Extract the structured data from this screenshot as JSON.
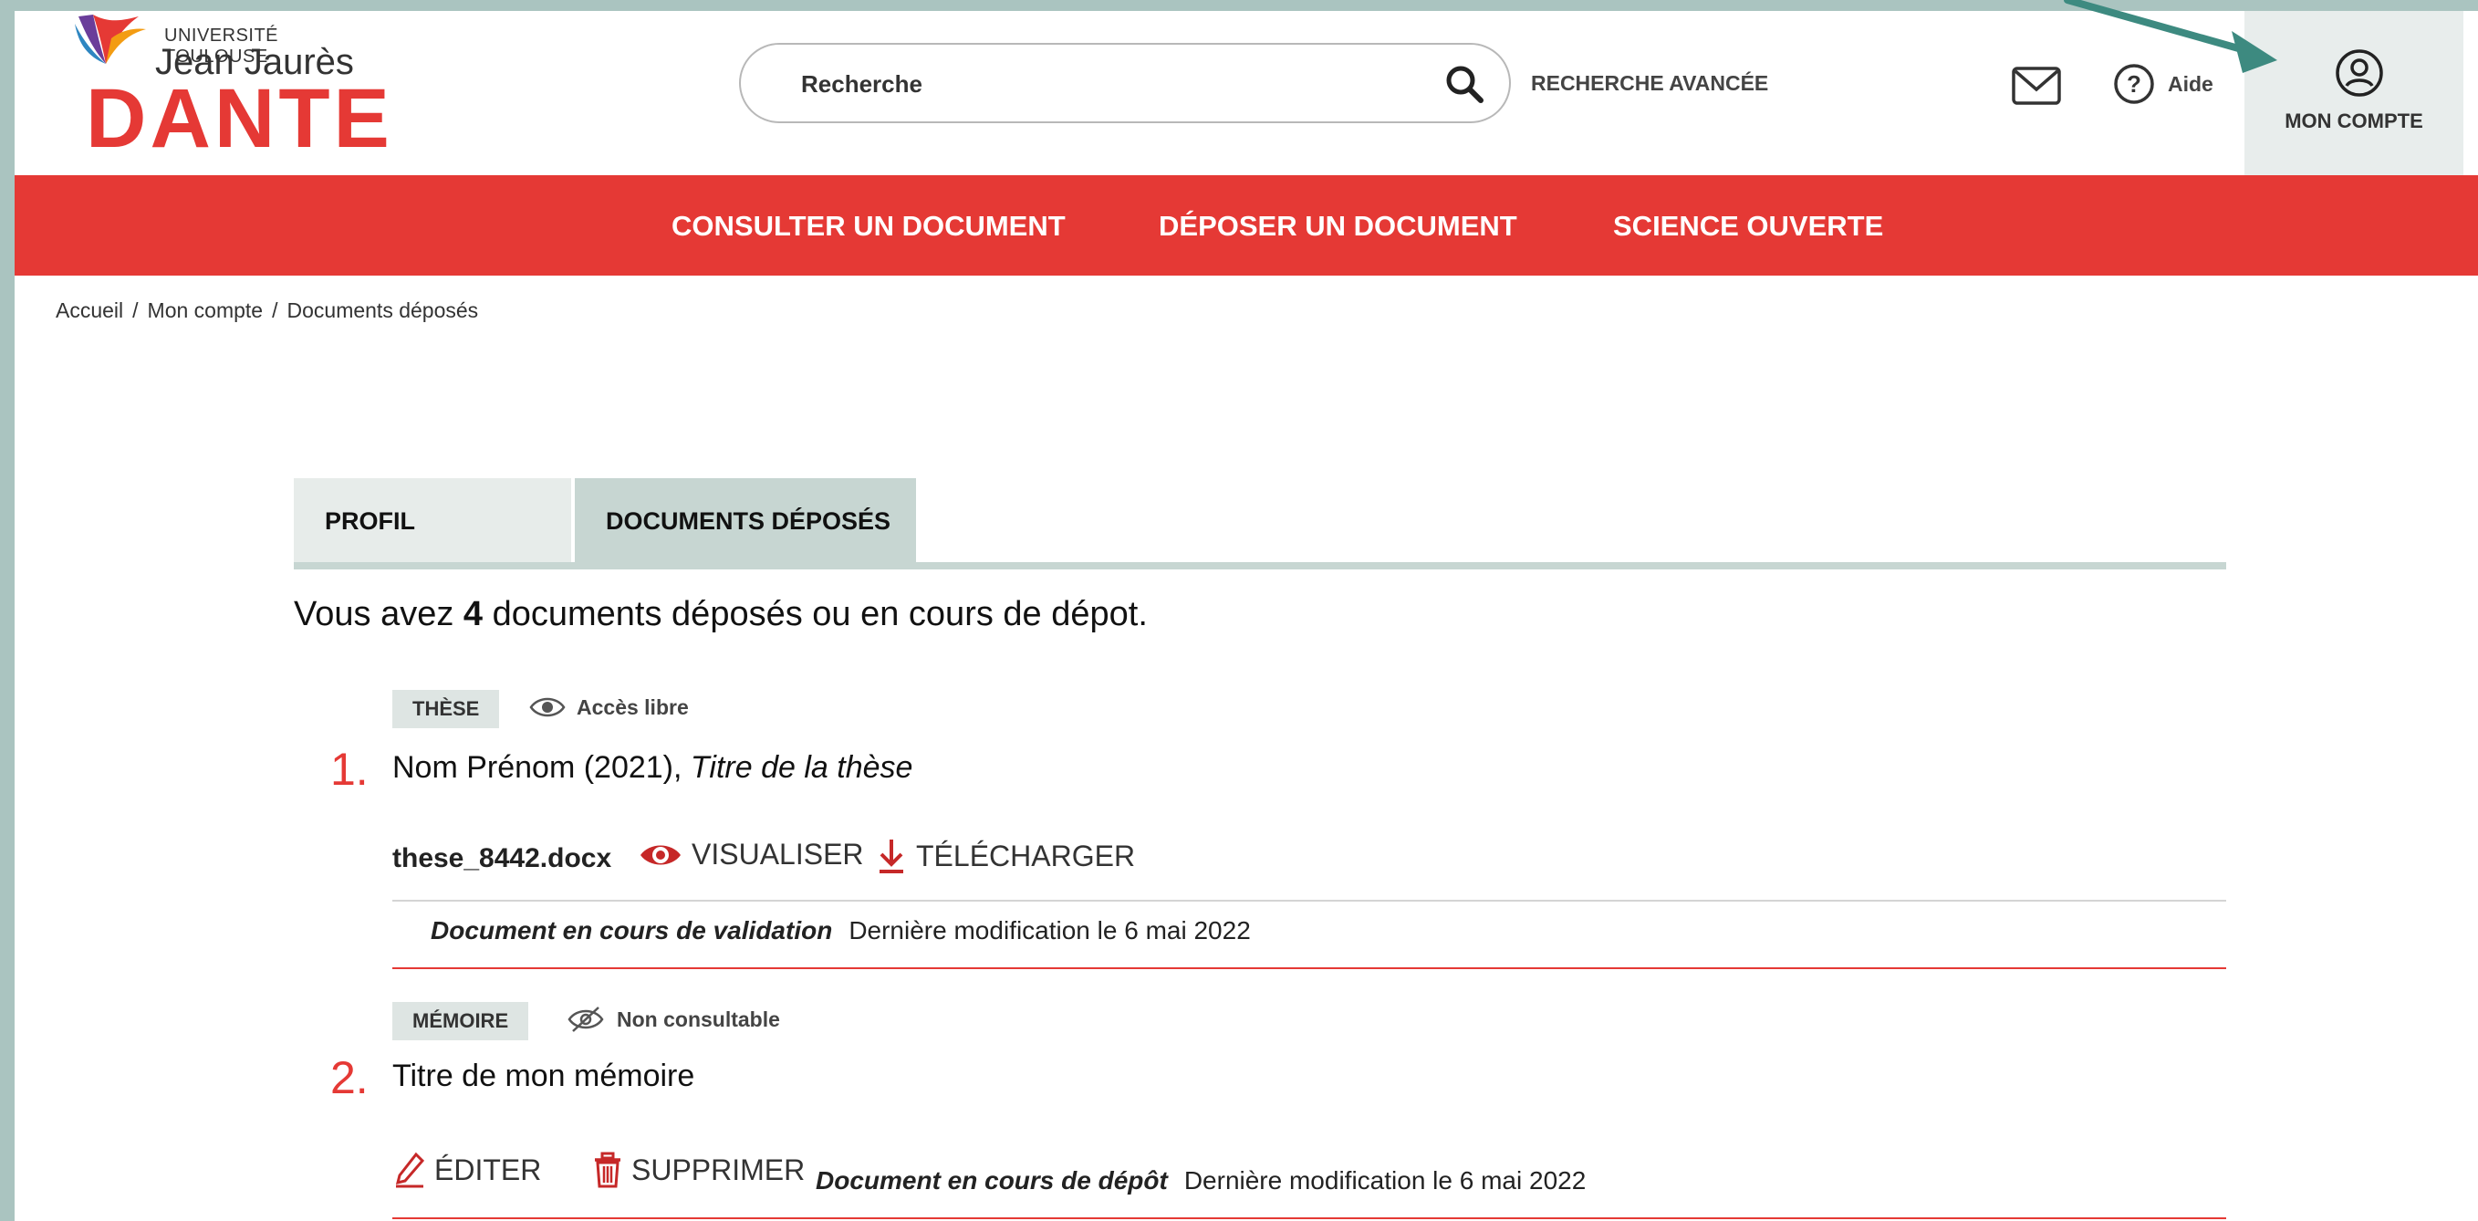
{
  "logo": {
    "university": "UNIVERSITÉ TOULOUSE",
    "name": "Jean Jaurès",
    "app": "DANTE"
  },
  "search": {
    "placeholder": "Recherche"
  },
  "header": {
    "advanced_search": "RECHERCHE AVANCÉE",
    "help": "Aide",
    "account": "MON COMPTE"
  },
  "nav": [
    {
      "label": "CONSULTER UN DOCUMENT"
    },
    {
      "label": "DÉPOSER UN DOCUMENT"
    },
    {
      "label": "SCIENCE OUVERTE"
    }
  ],
  "breadcrumb": [
    "Accueil",
    "Mon compte",
    "Documents déposés"
  ],
  "tabs": [
    {
      "label": "PROFIL",
      "active": false
    },
    {
      "label": "DOCUMENTS DÉPOSÉS",
      "active": true
    }
  ],
  "summary": {
    "prefix": "Vous avez",
    "count": "4",
    "suffix": "documents déposés ou en cours de dépot."
  },
  "documents": [
    {
      "number": "1.",
      "type": "THÈSE",
      "access": "Accès libre",
      "author_year": "Nom Prénom (2021),",
      "title": "Titre de la thèse",
      "file": "these_8442.docx",
      "actions": [
        "VISUALISER",
        "TÉLÉCHARGER"
      ],
      "status": "Document en cours de validation",
      "modified": "Dernière modification le 6 mai 2022"
    },
    {
      "number": "2.",
      "type": "MÉMOIRE",
      "access": "Non consultable",
      "title": "Titre de mon mémoire",
      "actions": [
        "ÉDITER",
        "SUPPRIMER"
      ],
      "status": "Document en cours de dépôt",
      "modified": "Dernière modification le 6 mai 2022"
    }
  ],
  "colors": {
    "brand_red": "#e53935",
    "tab_active": "#c7d6d2",
    "tab_inactive": "#e7ecea",
    "page_bg": "#aac4c0",
    "annotation_arrow": "#3d8a80"
  }
}
